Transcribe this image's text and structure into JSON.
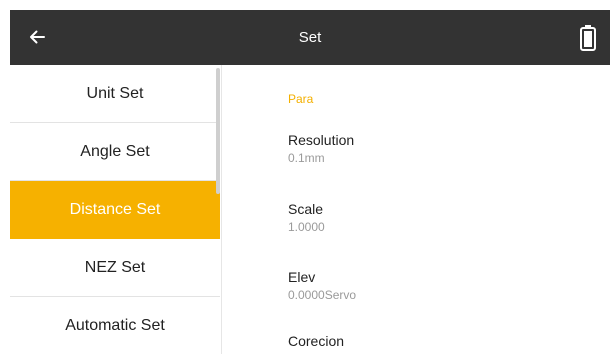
{
  "header": {
    "title": "Set",
    "back_icon": "arrow-left-icon",
    "battery_icon": "battery-full-icon",
    "background": "#333333"
  },
  "sidebar": {
    "items": [
      {
        "label": "Unit Set",
        "active": false
      },
      {
        "label": "Angle Set",
        "active": false
      },
      {
        "label": "Distance Set",
        "active": true
      },
      {
        "label": "NEZ Set",
        "active": false
      },
      {
        "label": "Automatic Set",
        "active": false
      }
    ],
    "active_color": "#f6b100"
  },
  "content": {
    "section_title": "Para",
    "settings": [
      {
        "label": "Resolution",
        "value": "0.1mm"
      },
      {
        "label": "Scale",
        "value": "1.0000"
      },
      {
        "label": "Elev",
        "value": "0.0000Servo"
      },
      {
        "label": "Corecion",
        "value": ""
      }
    ],
    "accent_color": "#f4b000"
  }
}
